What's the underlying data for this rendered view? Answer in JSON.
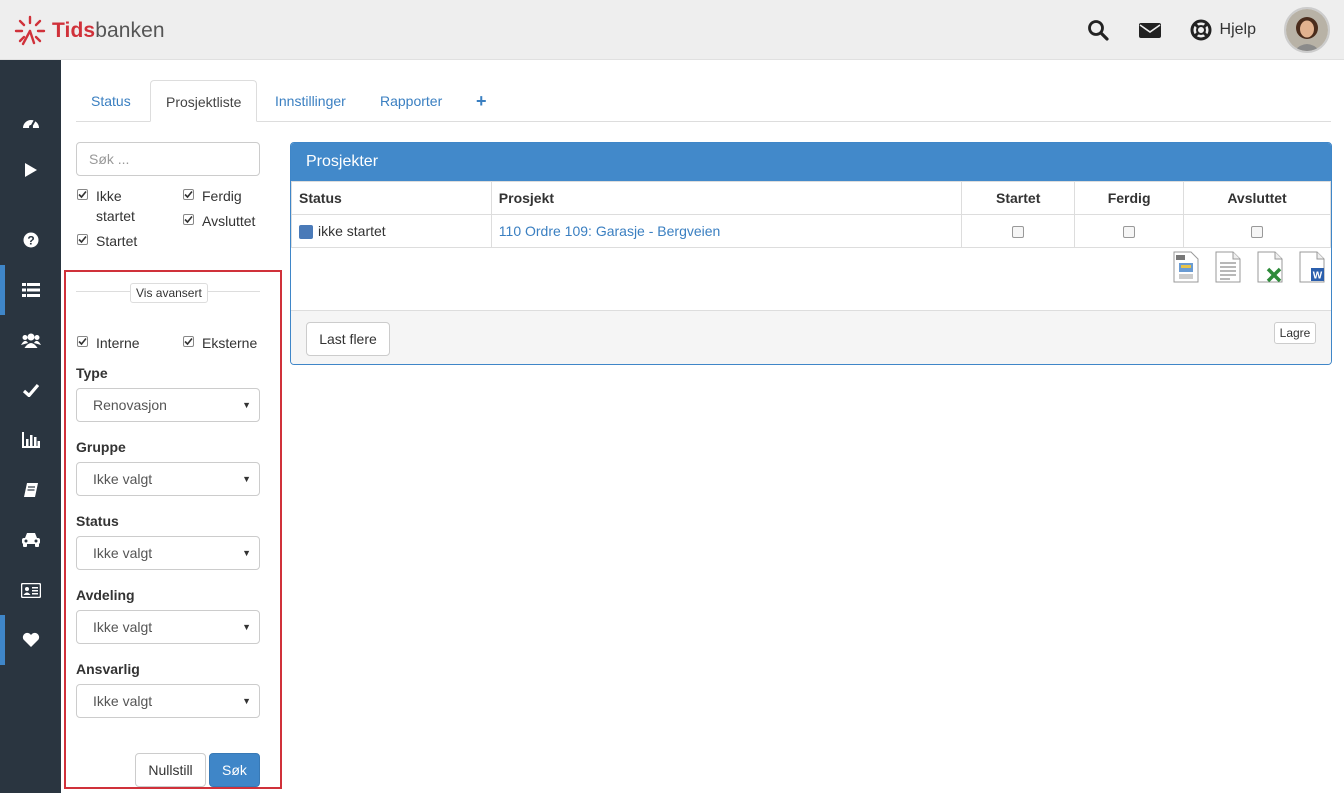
{
  "header": {
    "brand_part1": "Tids",
    "brand_part2": "banken",
    "help_label": "Hjelp",
    "icons": [
      "search-icon",
      "envelope-icon",
      "lifebuoy-icon",
      "avatar"
    ]
  },
  "sidebar": {
    "items": [
      {
        "icon": "dashboard-icon",
        "active": false
      },
      {
        "icon": "play-icon",
        "active": false
      },
      {
        "icon": "question-icon",
        "active": false
      },
      {
        "icon": "list-icon",
        "active": true
      },
      {
        "icon": "users-icon",
        "active": false
      },
      {
        "icon": "check-icon",
        "active": false
      },
      {
        "icon": "bar-chart-icon",
        "active": false
      },
      {
        "icon": "book-icon",
        "active": false
      },
      {
        "icon": "car-icon",
        "active": false
      },
      {
        "icon": "id-card-icon",
        "active": false
      },
      {
        "icon": "heart-icon",
        "active": true
      }
    ]
  },
  "tabs": [
    {
      "label": "Status",
      "active": false
    },
    {
      "label": "Prosjektliste",
      "active": true
    },
    {
      "label": "Innstillinger",
      "active": false
    },
    {
      "label": "Rapporter",
      "active": false
    },
    {
      "label": "+",
      "active": false
    }
  ],
  "filters": {
    "search_placeholder": "Søk ...",
    "status_checks": [
      {
        "label": "Ikke startet",
        "checked": true
      },
      {
        "label": "Ferdig",
        "checked": true
      },
      {
        "label": "Startet",
        "checked": true
      },
      {
        "label": "Avsluttet",
        "checked": true
      }
    ],
    "advanced_label": "Vis avansert",
    "scope_checks": [
      {
        "label": "Interne",
        "checked": true
      },
      {
        "label": "Eksterne",
        "checked": true
      }
    ],
    "type_label": "Type",
    "type_value": "Renovasjon",
    "group_label": "Gruppe",
    "group_value": "Ikke valgt",
    "status_label": "Status",
    "status_value": "Ikke valgt",
    "department_label": "Avdeling",
    "department_value": "Ikke valgt",
    "responsible_label": "Ansvarlig",
    "responsible_value": "Ikke valgt",
    "reset_label": "Nullstill",
    "search_label": "Søk"
  },
  "projects": {
    "title": "Prosjekter",
    "columns": [
      "Status",
      "Prosjekt",
      "Startet",
      "Ferdig",
      "Avsluttet"
    ],
    "rows": [
      {
        "status": "ikke startet",
        "project": "110 Ordre 109: Garasje - Bergveien",
        "started": false,
        "finished": false,
        "closed": false
      }
    ],
    "exports": [
      "print-icon",
      "document-icon",
      "excel-icon",
      "word-icon"
    ],
    "load_more_label": "Last flere",
    "save_label": "Lagre"
  },
  "colors": {
    "accent": "#3f86c8",
    "sidebar": "#2a3540",
    "brand_red": "#d0313a",
    "highlight_box": "#d0313a"
  }
}
